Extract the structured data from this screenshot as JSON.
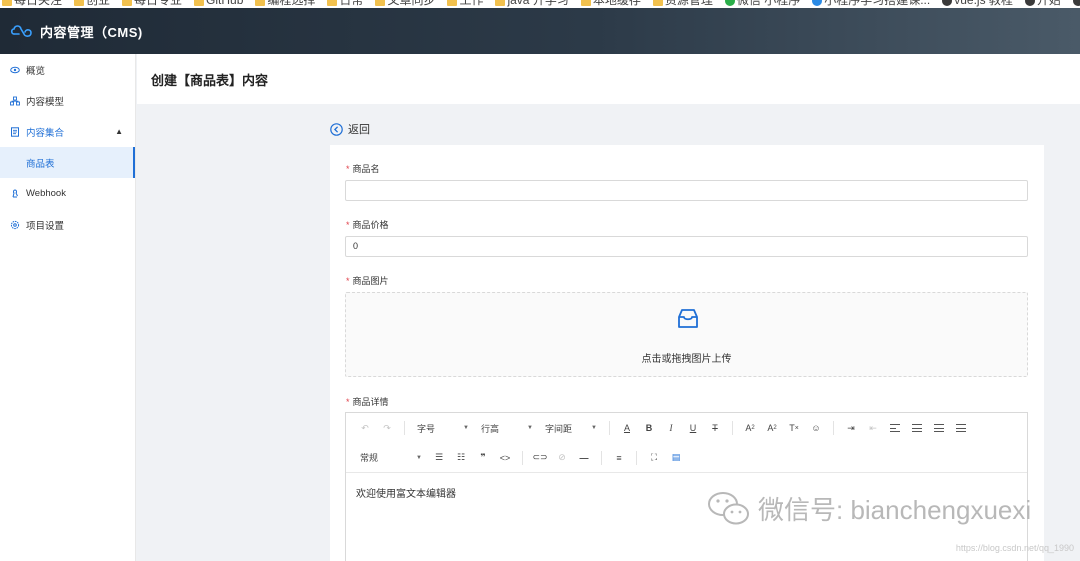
{
  "bookmarks": [
    {
      "label": "每日关注",
      "style": "folder"
    },
    {
      "label": "创业",
      "style": "folder"
    },
    {
      "label": "每日专业",
      "style": "folder"
    },
    {
      "label": "GitHub",
      "style": "folder"
    },
    {
      "label": "编程选择",
      "style": "folder"
    },
    {
      "label": "日常",
      "style": "folder"
    },
    {
      "label": "文章同步",
      "style": "folder"
    },
    {
      "label": "工作",
      "style": "folder"
    },
    {
      "label": "java 开学习",
      "style": "folder"
    },
    {
      "label": "本地缓存",
      "style": "folder"
    },
    {
      "label": "资源管理",
      "style": "folder"
    },
    {
      "label": "微信 小程序",
      "style": "green"
    },
    {
      "label": "小程序学习搭建课...",
      "style": "blue"
    },
    {
      "label": "vue.js 教程",
      "style": "dark"
    },
    {
      "label": "开始",
      "style": "dark"
    },
    {
      "label": "vue.js",
      "style": "dark"
    }
  ],
  "header": {
    "title": "内容管理（CMS)",
    "logo_icon": "cloud-logo-icon"
  },
  "sidebar": {
    "items": [
      {
        "label": "概览",
        "icon": "eye-icon"
      },
      {
        "label": "内容模型",
        "icon": "model-icon"
      },
      {
        "label": "内容集合",
        "icon": "collection-icon",
        "expanded": true
      },
      {
        "label": "商品表",
        "active": true
      },
      {
        "label": "Webhook",
        "icon": "webhook-icon"
      },
      {
        "label": "项目设置",
        "icon": "settings-icon"
      }
    ]
  },
  "page": {
    "title": "创建【商品表】内容",
    "back_label": "返回"
  },
  "form": {
    "required_mark": "*",
    "name_label": "商品名",
    "name_value": "",
    "price_label": "商品价格",
    "price_value": "0",
    "image_label": "商品图片",
    "upload_text": "点击或拖拽图片上传",
    "detail_label": "商品详情"
  },
  "editor": {
    "font_size_label": "字号",
    "line_height_label": "行高",
    "letter_spacing_label": "字间距",
    "paragraph_label": "常规",
    "content": "欢迎使用富文本编辑器",
    "bold": "B",
    "italic": "I",
    "underline": "U",
    "strike": "T",
    "underline_color": "A",
    "superscript": "A",
    "subscript": "A",
    "clear_format": "T",
    "quote": "❞",
    "code": "<>",
    "hr": "—"
  },
  "watermark": {
    "text": "微信号: bianchengxuexi",
    "url": "https://blog.csdn.net/qq_1990"
  },
  "colors": {
    "accent": "#1f6fd6",
    "header_bg": "#1f2a36",
    "required": "#e0414b"
  }
}
